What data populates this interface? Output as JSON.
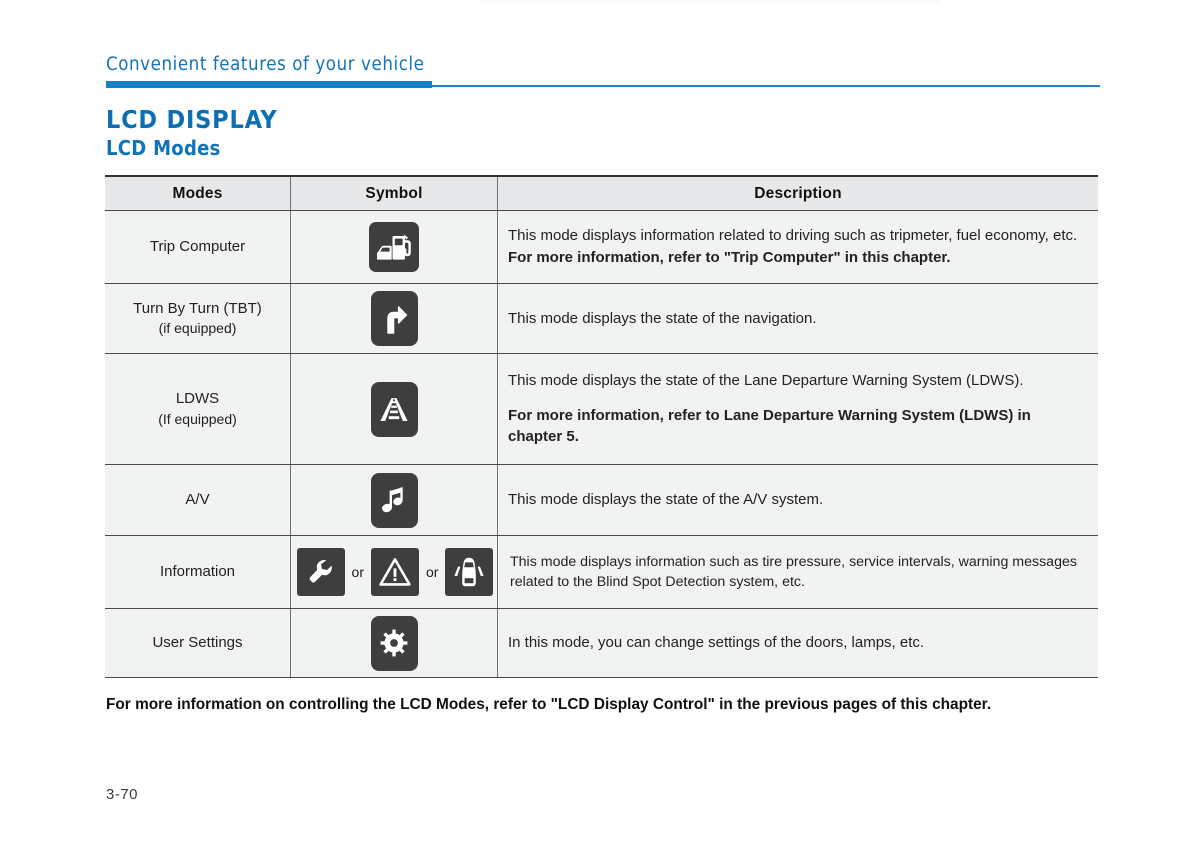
{
  "header": {
    "chapter_title": "Convenient features of your vehicle"
  },
  "section": {
    "title": "LCD DISPLAY",
    "subtitle": "LCD Modes"
  },
  "table": {
    "columns": [
      "Modes",
      "Symbol",
      "Description"
    ],
    "rows": [
      {
        "mode": "Trip Computer",
        "mode_sub": "",
        "icon": "fuel-pump-car-icon",
        "desc_line1": "This mode displays information related to driving such as tripmeter, fuel economy, etc.",
        "desc_line2": "For more information, refer to \"Trip Computer\" in this chapter."
      },
      {
        "mode": "Turn By Turn (TBT)",
        "mode_sub": "(if equipped)",
        "icon": "turn-right-arrow-icon",
        "desc_line1": "This mode displays the state of the navigation.",
        "desc_line2": ""
      },
      {
        "mode": "LDWS",
        "mode_sub": "(If equipped)",
        "icon": "lane-departure-road-icon",
        "desc_line1": "This mode displays the state of the Lane Departure Warning System (LDWS).",
        "desc_line2": "For more information, refer to Lane Departure Warning System (LDWS) in chapter 5."
      },
      {
        "mode": "A/V",
        "mode_sub": "",
        "icon": "music-note-icon",
        "desc_line1": "This mode displays the state of the A/V system.",
        "desc_line2": ""
      },
      {
        "mode": "Information",
        "mode_sub": "",
        "icons": [
          "wrench-icon",
          "warning-triangle-icon",
          "blind-spot-car-icon"
        ],
        "separator": "or",
        "desc_line1": "This mode displays information such as tire pressure, service intervals, warning messages related to the Blind Spot Detection system, etc.",
        "desc_line2": ""
      },
      {
        "mode": "User Settings",
        "mode_sub": "",
        "icon": "gear-icon",
        "desc_line1": "In this mode, you can change settings of the doors, lamps, etc.",
        "desc_line2": ""
      }
    ]
  },
  "closing_note": "For more information on controlling the LCD Modes, refer to \"LCD Display Control\" in the previous pages of this chapter.",
  "page_number": "3-70",
  "colors": {
    "accent_blue": "#1273b8",
    "rule_blue": "#1380c4",
    "icon_tile": "#3e3e3e",
    "table_fill": "#f1f2f2",
    "header_fill": "#e7e8e9"
  }
}
